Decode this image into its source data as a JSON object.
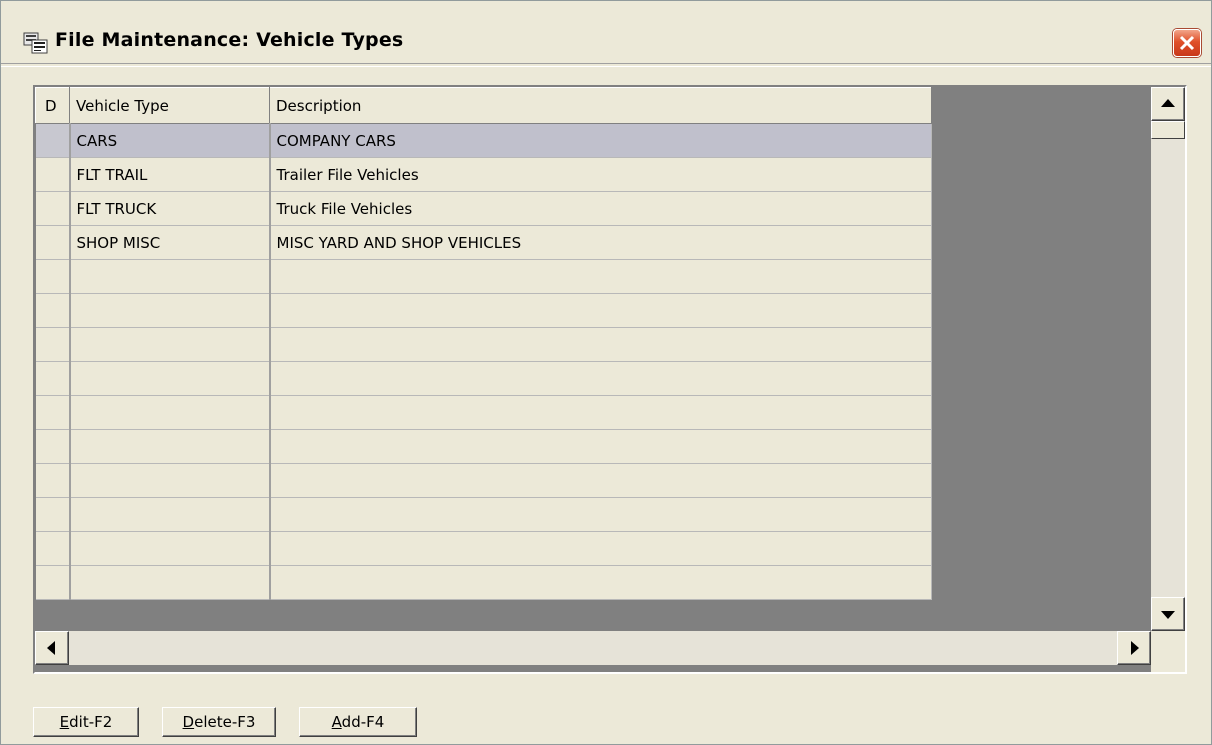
{
  "window": {
    "title": "File Maintenance: Vehicle Types"
  },
  "grid": {
    "columns": [
      "D",
      "Vehicle Type",
      "Description"
    ],
    "rows": [
      {
        "d": "",
        "vehicle_type": "CARS",
        "description": "COMPANY CARS",
        "selected": true
      },
      {
        "d": "",
        "vehicle_type": "FLT TRAIL",
        "description": "Trailer File Vehicles"
      },
      {
        "d": "",
        "vehicle_type": "FLT TRUCK",
        "description": "Truck File Vehicles"
      },
      {
        "d": "",
        "vehicle_type": "SHOP MISC",
        "description": "MISC YARD AND SHOP VEHICLES"
      }
    ]
  },
  "buttons": {
    "edit": {
      "accel": "E",
      "rest": "dit-F2"
    },
    "delete": {
      "accel": "D",
      "rest": "elete-F3"
    },
    "add": {
      "accel": "A",
      "rest": "dd-F4"
    }
  },
  "colors": {
    "face": "#ece9d8",
    "selected_row": "#c0c0cc",
    "grid_empty": "#808080",
    "close_button": "#e0502a"
  },
  "icons": {
    "title": "app-icon",
    "close": "close-icon",
    "scroll_up": "arrow-up-icon",
    "scroll_down": "arrow-down-icon",
    "scroll_left": "arrow-left-icon",
    "scroll_right": "arrow-right-icon"
  }
}
